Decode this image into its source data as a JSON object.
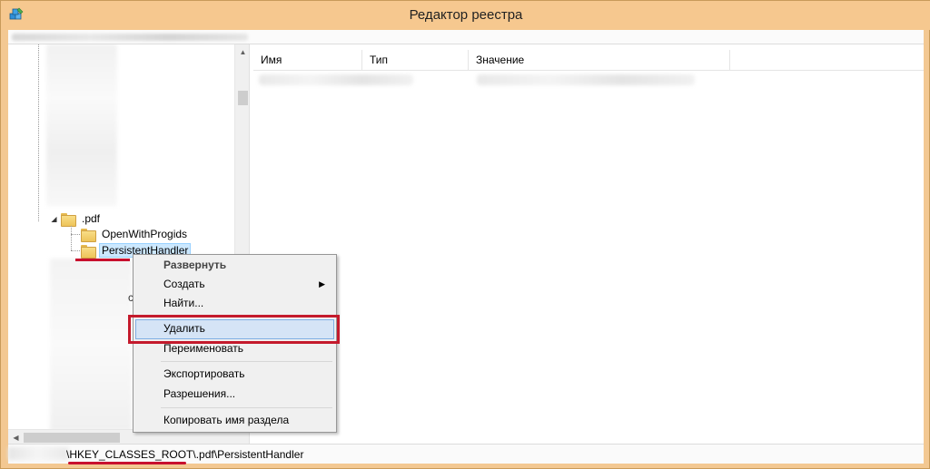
{
  "window": {
    "title": "Редактор реестра"
  },
  "tree": {
    "nodes": [
      {
        "label": ".pdf",
        "expanded": true
      },
      {
        "label": "OpenWithProgids"
      },
      {
        "label": "PersistentHandler",
        "selected": true
      }
    ],
    "fragment_text": "c"
  },
  "list": {
    "columns": [
      "Имя",
      "Тип",
      "Значение"
    ]
  },
  "context_menu": {
    "items": [
      {
        "label": "Развернуть",
        "bold": true
      },
      {
        "label": "Создать",
        "submenu": true
      },
      {
        "label": "Найти..."
      },
      {
        "label": "Удалить",
        "highlighted": true
      },
      {
        "label": "Переименовать"
      },
      {
        "label": "Экспортировать"
      },
      {
        "label": "Разрешения..."
      },
      {
        "label": "Копировать имя раздела"
      }
    ],
    "submenu_glyph": "▶"
  },
  "statusbar": {
    "path": "\\HKEY_CLASSES_ROOT\\.pdf\\PersistentHandler"
  },
  "colors": {
    "frame": "#f3c892",
    "selection": "#cce8ff",
    "menu_highlight": "#d5e4f6",
    "annotation_red": "#c41a2c"
  }
}
